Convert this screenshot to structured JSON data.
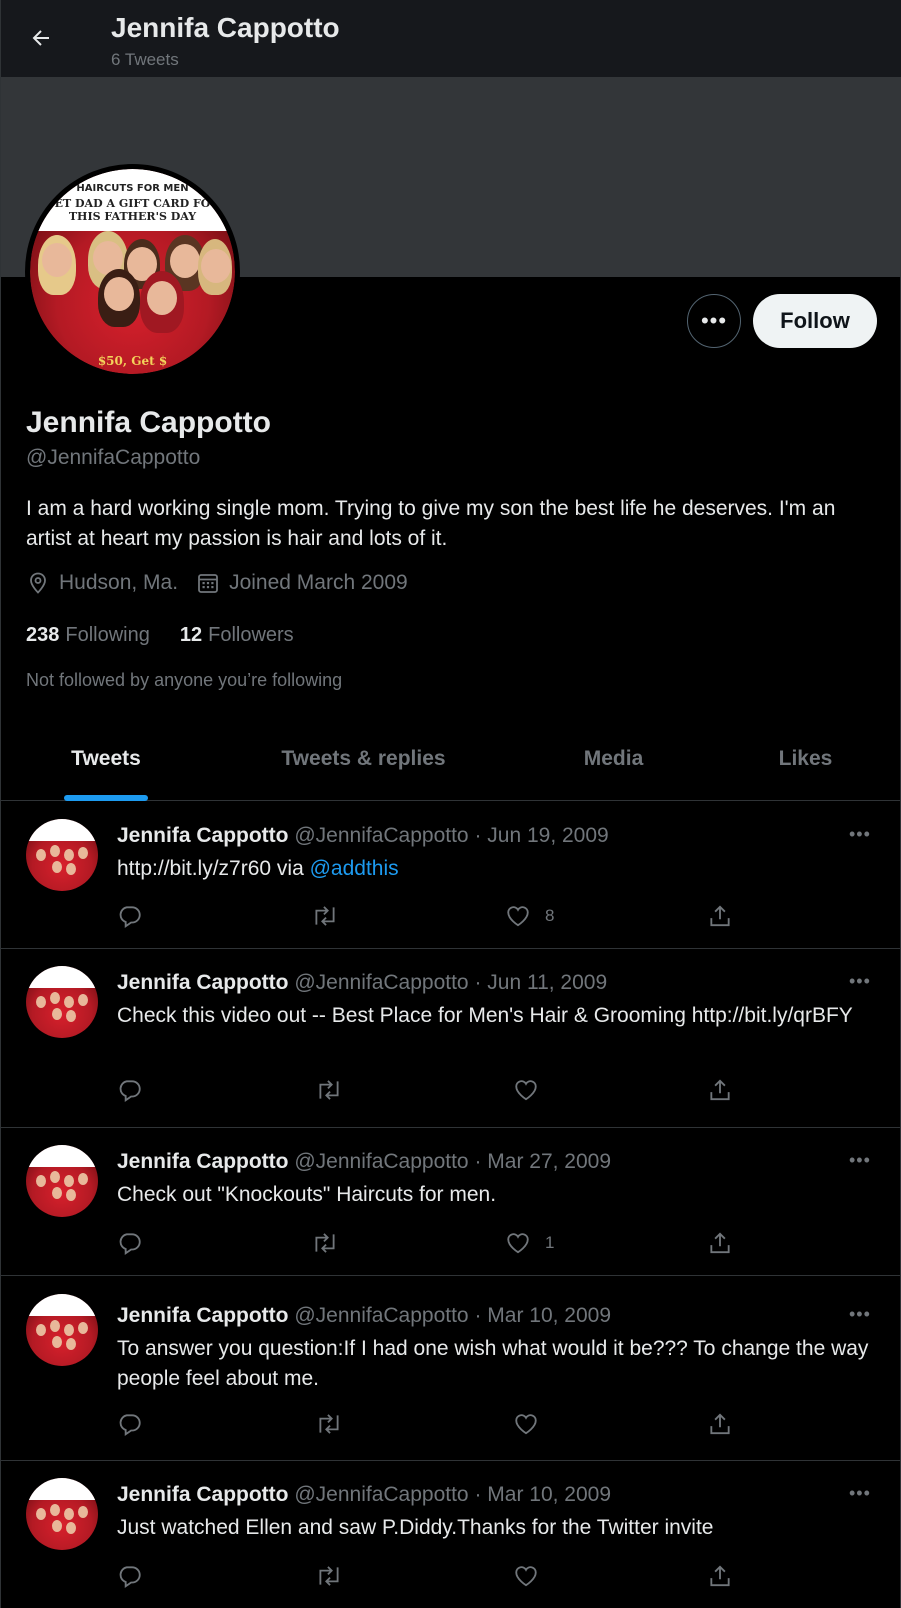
{
  "header": {
    "title": "Jennifa Cappotto",
    "subtitle": "6 Tweets"
  },
  "avatar": {
    "line1": "HAIRCUTS FOR MEN",
    "line2": "ET DAD A GIFT CARD FO",
    "line3": "THIS FATHER'S DAY",
    "line4": "$50, Get $"
  },
  "actions": {
    "more": "•••",
    "follow": "Follow"
  },
  "profile": {
    "name": "Jennifa Cappotto",
    "handle": "@JennifaCappotto",
    "bio": "I am a hard working single mom. Trying to give my son the best life he deserves. I'm an artist at heart my passion is hair and lots of it.",
    "location": "Hudson, Ma.",
    "joined": "Joined March 2009",
    "following_count": "238",
    "following_label": "Following",
    "followers_count": "12",
    "followers_label": "Followers",
    "note": "Not followed by anyone you’re following"
  },
  "tabs": [
    {
      "label": "Tweets"
    },
    {
      "label": "Tweets & replies"
    },
    {
      "label": "Media"
    },
    {
      "label": "Likes"
    }
  ],
  "tweets": [
    {
      "name": "Jennifa Cappotto",
      "meta": "@JennifaCappotto · Jun 19, 2009",
      "text": "http://bit.ly/z7r60 via ",
      "mention": "@addthis",
      "likes": "8"
    },
    {
      "name": "Jennifa Cappotto",
      "meta": "@JennifaCappotto · Jun 11, 2009",
      "text": "Check this video out -- Best Place for Men's Hair & Grooming http://bit.ly/qrBFY",
      "likes": ""
    },
    {
      "name": "Jennifa Cappotto",
      "meta": "@JennifaCappotto · Mar 27, 2009",
      "text": "Check out \"Knockouts\" Haircuts for men.",
      "likes": "1"
    },
    {
      "name": "Jennifa Cappotto",
      "meta": "@JennifaCappotto · Mar 10, 2009",
      "text": "To answer you question:If I had one wish what would it be??? To change the way people feel about me.",
      "likes": ""
    },
    {
      "name": "Jennifa Cappotto",
      "meta": "@JennifaCappotto · Mar 10, 2009",
      "text": "Just watched Ellen and saw P.Diddy.Thanks for the Twitter invite",
      "likes": ""
    }
  ],
  "tweet_more": "•••",
  "icons": [
    "back-arrow-icon",
    "location-icon",
    "calendar-icon",
    "reply-icon",
    "retweet-icon",
    "like-icon",
    "share-icon"
  ],
  "colors": {
    "accent": "#1d9bf0",
    "background": "#000000",
    "muted": "#71767b"
  }
}
